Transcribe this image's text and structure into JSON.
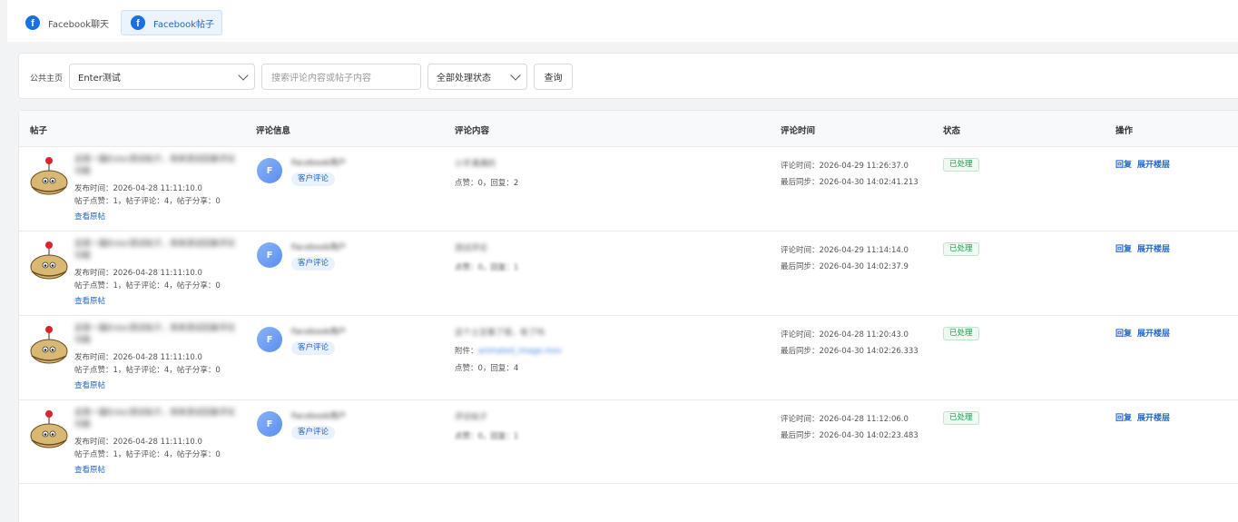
{
  "tabs": [
    {
      "label": "Facebook聊天",
      "active": false
    },
    {
      "label": "Facebook帖子",
      "active": true
    }
  ],
  "filter": {
    "page_label": "公共主页",
    "page_value": "Enter测试",
    "search_placeholder": "搜索评论内容或帖子内容",
    "status_value": "全部处理状态",
    "query_button": "查询"
  },
  "table": {
    "headers": {
      "post": "帖子",
      "comment_info": "评论信息",
      "comment_content": "评论内容",
      "comment_time": "评论时间",
      "status": "状态",
      "actions": "操作"
    },
    "rows": [
      {
        "post_title": "这是一篇Enter测试帖子，用来测试回复评论功能",
        "publish_time": "发布时间：2026-04-28 11:11:10.0",
        "post_stats": "帖子点赞：1，帖子评论：4，帖子分享：0",
        "view_original": "查看原帖",
        "user_name": "Facebook用户",
        "user_avatar_letter": "F",
        "user_tag": "客户评论",
        "content": "小手满满的",
        "attachment_label": "",
        "attachment_value": "",
        "comment_stats": "点赞：0，回复：2",
        "comment_time": "评论时间：2026-04-29 11:26:37.0",
        "sync_time": "最后同步：2026-04-30 14:02:41.213",
        "status": "已处理",
        "reply": "回复",
        "expand": "展开楼层"
      },
      {
        "post_title": "这是一篇Enter测试帖子，用来测试回复评论功能",
        "publish_time": "发布时间：2026-04-28 11:11:10.0",
        "post_stats": "帖子点赞：1，帖子评论：4，帖子分享：0",
        "view_original": "查看原帖",
        "user_name": "Facebook用户",
        "user_avatar_letter": "F",
        "user_tag": "客户评论",
        "content": "测试评论",
        "attachment_label": "",
        "attachment_value": "",
        "comment_stats": "点赞：0，回复：1",
        "comment_time": "评论时间：2026-04-29 11:14:14.0",
        "sync_time": "最后同步：2026-04-30 14:02:37.9",
        "status": "已处理",
        "reply": "回复",
        "expand": "展开楼层"
      },
      {
        "post_title": "这是一篇Enter测试帖子，用来测试回复评论功能",
        "publish_time": "发布时间：2026-04-28 11:11:10.0",
        "post_stats": "帖子点赞：1，帖子评论：4，帖子分享：0",
        "view_original": "查看原帖",
        "user_name": "Facebook用户",
        "user_avatar_letter": "F",
        "user_tag": "客户评论",
        "content": "这个土豆看了很，有了吗",
        "attachment_label": "附件：",
        "attachment_value": "animated_image.mov",
        "comment_stats": "点赞：0，回复：4",
        "comment_time": "评论时间：2026-04-28 11:20:43.0",
        "sync_time": "最后同步：2026-04-30 14:02:26.333",
        "status": "已处理",
        "reply": "回复",
        "expand": "展开楼层"
      },
      {
        "post_title": "这是一篇Enter测试帖子，用来测试回复评论功能",
        "publish_time": "发布时间：2026-04-28 11:11:10.0",
        "post_stats": "帖子点赞：1，帖子评论：4，帖子分享：0",
        "view_original": "查看原帖",
        "user_name": "Facebook用户",
        "user_avatar_letter": "F",
        "user_tag": "客户评论",
        "content": "评论帖子",
        "attachment_label": "",
        "attachment_value": "",
        "comment_stats": "点赞：0，回复：1",
        "comment_time": "评论时间：2026-04-28 11:12:06.0",
        "sync_time": "最后同步：2026-04-30 14:02:23.483",
        "status": "已处理",
        "reply": "回复",
        "expand": "展开楼层"
      }
    ]
  }
}
